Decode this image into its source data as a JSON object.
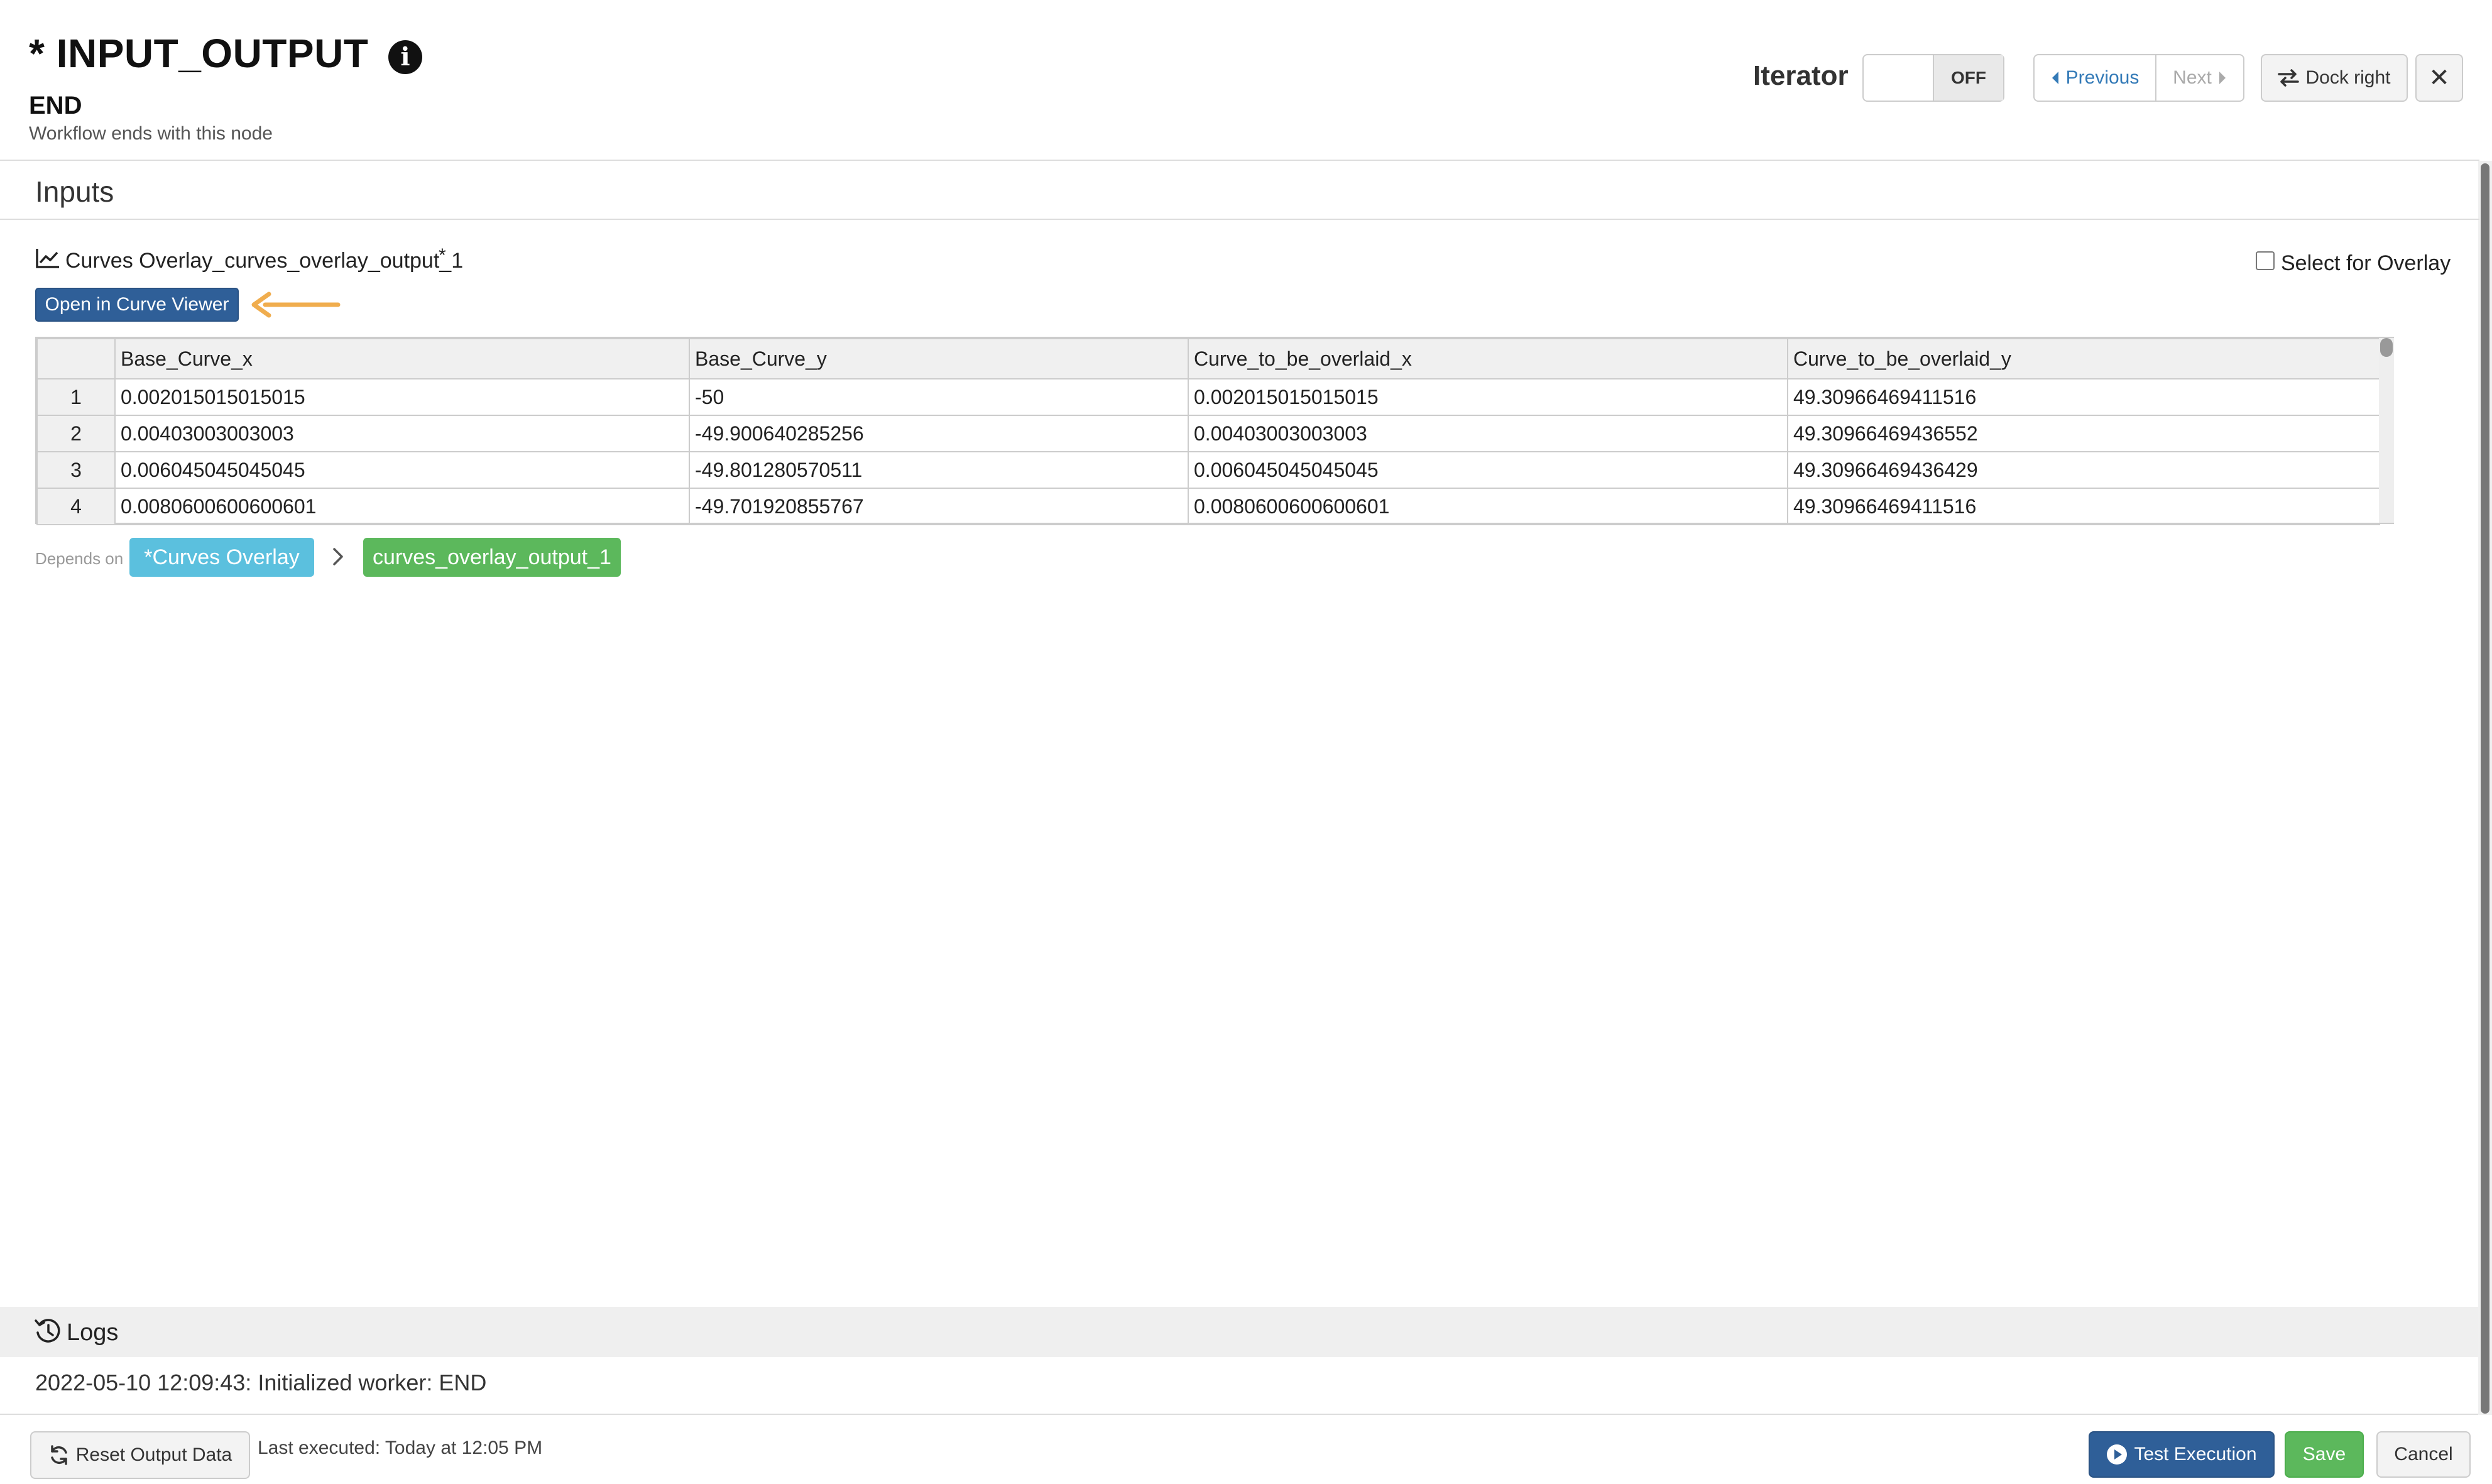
{
  "header": {
    "title": "* INPUT_OUTPUT",
    "subtitle": "END",
    "description": "Workflow ends with this node",
    "iterator_label": "Iterator",
    "iterator_state": "OFF",
    "previous_label": "Previous",
    "next_label": "Next",
    "dock_label": "Dock right",
    "close_label": "✕"
  },
  "inputs": {
    "section_title": "Inputs",
    "output_name": "Curves Overlay_curves_overlay_output_1",
    "required_mark": "*",
    "select_overlay_label": "Select for Overlay",
    "open_viewer_label": "Open in Curve Viewer",
    "table": {
      "columns": [
        "",
        "Base_Curve_x",
        "Base_Curve_y",
        "Curve_to_be_overlaid_x",
        "Curve_to_be_overlaid_y"
      ],
      "rows": [
        [
          "1",
          "0.002015015015015",
          "-50",
          "0.002015015015015",
          "49.30966469411516"
        ],
        [
          "2",
          "0.00403003003003",
          "-49.900640285256",
          "0.00403003003003",
          "49.30966469436552"
        ],
        [
          "3",
          "0.006045045045045",
          "-49.801280570511",
          "0.006045045045045",
          "49.30966469436429"
        ],
        [
          "4",
          "0.0080600600600601",
          "-49.701920855767",
          "0.0080600600600601",
          "49.30966469411516"
        ]
      ]
    },
    "depends_on_label": "Depends on",
    "dependency_node": "*Curves Overlay",
    "dependency_output": "curves_overlay_output_1"
  },
  "logs": {
    "title": "Logs",
    "entries": [
      {
        "timestamp": "2022-05-10 12:09:43:",
        "message": "Initialized worker: END"
      }
    ]
  },
  "footer": {
    "reset_label": "Reset Output Data",
    "last_executed": "Last executed: Today at 12:05 PM",
    "test_label": "Test Execution",
    "save_label": "Save",
    "cancel_label": "Cancel"
  },
  "colors": {
    "primary": "#2f5f98",
    "info_tag": "#5bc0de",
    "success": "#5cb85c",
    "arrow": "#f0ad4e"
  },
  "icons": [
    "info-icon",
    "caret-left-icon",
    "caret-right-icon",
    "swap-icon",
    "close-icon",
    "line-chart-icon",
    "chevron-right-icon",
    "history-icon",
    "refresh-icon",
    "play-circle-icon"
  ]
}
